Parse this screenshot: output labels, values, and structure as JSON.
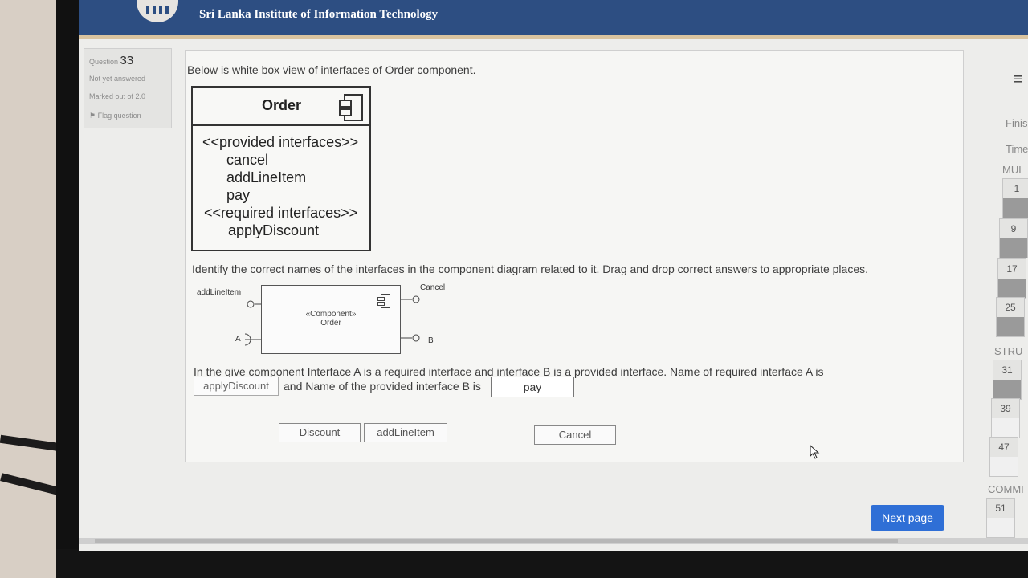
{
  "header": {
    "institute": "Sri Lanka Institute of Information Technology"
  },
  "question_info": {
    "label": "Question",
    "number": "33",
    "status": "Not yet answered",
    "marks": "Marked out of 2.0",
    "flag": "Flag question"
  },
  "question": {
    "intro": "Below is white box view of interfaces of Order component.",
    "order_box": {
      "title": "Order",
      "lines": [
        "<<provided interfaces>>",
        "cancel",
        "addLineItem",
        "pay",
        "<<required interfaces>>",
        "applyDiscount"
      ]
    },
    "instruction": "Identify the correct names of the interfaces in the component diagram related to it. Drag and drop correct answers to appropriate places.",
    "diagram": {
      "label_top_left": "addLineItem",
      "label_top_right": "Cancel",
      "stereotype": "«Component»",
      "name": "Order",
      "label_a": "A",
      "label_b": "B"
    },
    "sentence_1": "In the give component Interface A is a required interface and interface B is a provided interface. Name of required interface A is",
    "answer_a": "applyDiscount",
    "sentence_2": "and Name of the provided interface B is",
    "answer_b": "pay",
    "choices": [
      "Discount",
      "addLineItem",
      "Cancel"
    ]
  },
  "buttons": {
    "next": "Next page"
  },
  "nav": {
    "finish": "Finis",
    "time": "Time",
    "section1": "MUL",
    "section2": "STRU",
    "section3": "COMMI",
    "numbers": [
      "1",
      "9",
      "17",
      "25",
      "31",
      "39",
      "47",
      "51"
    ]
  }
}
